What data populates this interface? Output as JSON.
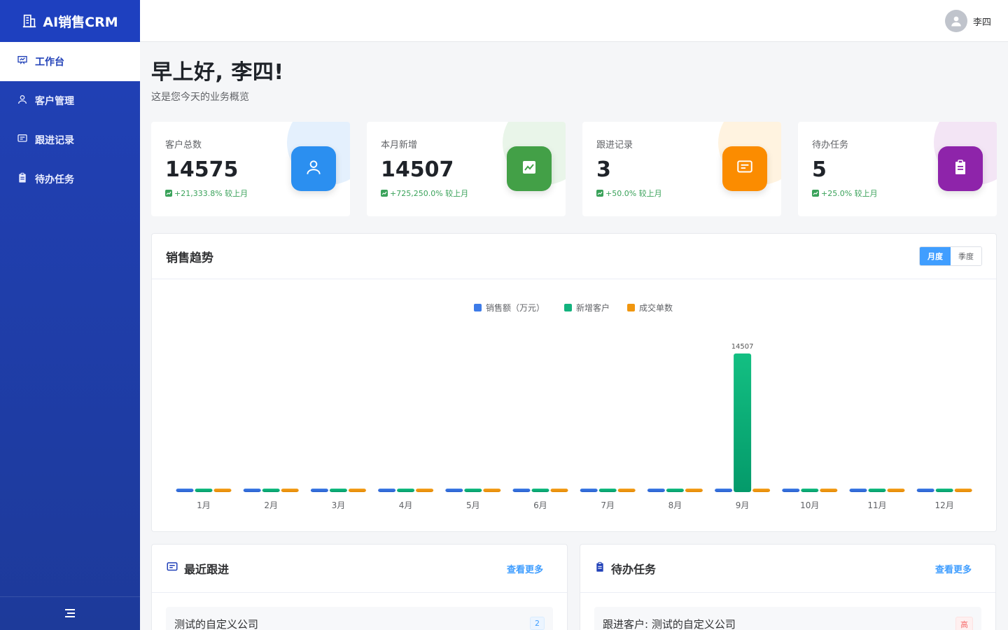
{
  "app": {
    "brand": "AI销售CRM"
  },
  "sidebar": {
    "items": [
      {
        "label": "工作台",
        "icon": "dashboard-icon",
        "active": true
      },
      {
        "label": "客户管理",
        "icon": "user-icon",
        "active": false
      },
      {
        "label": "跟进记录",
        "icon": "message-icon",
        "active": false
      },
      {
        "label": "待办任务",
        "icon": "clipboard-icon",
        "active": false
      }
    ]
  },
  "header": {
    "username": "李四"
  },
  "greeting": {
    "title": "早上好, 李四!",
    "subtitle": "这是您今天的业务概览"
  },
  "stats": [
    {
      "label": "客户总数",
      "value": "14575",
      "trend": "+21,333.8% 较上月",
      "color": "#2b8ff0",
      "blob": "#e4f0fd",
      "icon": "user-icon"
    },
    {
      "label": "本月新增",
      "value": "14507",
      "trend": "+725,250.0% 较上月",
      "color": "#43a047",
      "blob": "#e9f5e9",
      "icon": "trend-chart-icon"
    },
    {
      "label": "跟进记录",
      "value": "3",
      "trend": "+50.0% 较上月",
      "color": "#fb8c00",
      "blob": "#fff3e0",
      "icon": "message-icon"
    },
    {
      "label": "待办任务",
      "value": "5",
      "trend": "+25.0% 较上月",
      "color": "#8e24aa",
      "blob": "#f3e5f5",
      "icon": "clipboard-icon"
    }
  ],
  "sales_trend": {
    "title": "销售趋势",
    "tabs": {
      "monthly": "月度",
      "quarterly": "季度"
    }
  },
  "chart_data": {
    "type": "bar",
    "categories": [
      "1月",
      "2月",
      "3月",
      "4月",
      "5月",
      "6月",
      "7月",
      "8月",
      "9月",
      "10月",
      "11月",
      "12月"
    ],
    "series": [
      {
        "name": "销售额（万元）",
        "color": "#3d7be8",
        "values": [
          0,
          0,
          0,
          0,
          0,
          0,
          0,
          0,
          0,
          0,
          0,
          0
        ]
      },
      {
        "name": "新增客户",
        "color": "#13b37e",
        "values": [
          0,
          0,
          0,
          0,
          0,
          0,
          0,
          68,
          14507,
          0,
          0,
          0
        ]
      },
      {
        "name": "成交单数",
        "color": "#f0960f",
        "values": [
          0,
          0,
          0,
          0,
          0,
          0,
          0,
          0,
          0,
          0,
          0,
          0
        ]
      }
    ],
    "data_labels": [
      {
        "series": 1,
        "index": 8,
        "text": "14507"
      }
    ],
    "ylim": [
      0,
      14507
    ],
    "legend": "top-center",
    "grid": false
  },
  "recent_follow": {
    "title": "最近跟进",
    "more": "查看更多",
    "items": [
      {
        "title": "测试的自定义公司",
        "badge": "2"
      }
    ]
  },
  "todo": {
    "title": "待办任务",
    "more": "查看更多",
    "items": [
      {
        "title": "跟进客户: 测试的自定义公司",
        "badge": "高"
      }
    ]
  }
}
